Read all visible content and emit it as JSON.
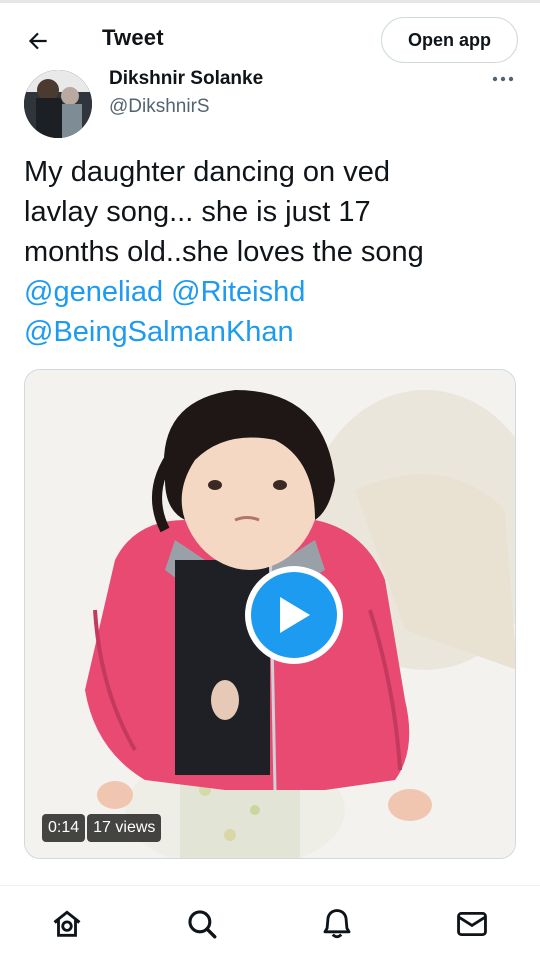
{
  "header": {
    "title": "Tweet",
    "open_app_label": "Open app"
  },
  "author": {
    "name": "Dikshnir Solanke",
    "handle": "@DikshnirS"
  },
  "tweet": {
    "text_lines": [
      "My daughter dancing on ved",
      "lavlay song... she is just 17",
      "months old..she loves the song"
    ],
    "mentions": [
      "@geneliad",
      "@Riteishd",
      "@BeingSalmanKhan"
    ]
  },
  "video": {
    "duration": "0:14",
    "views": "17 views"
  },
  "bottom_nav": {
    "items": [
      "home-icon",
      "search-icon",
      "notifications-icon",
      "messages-icon"
    ]
  },
  "colors": {
    "accent": "#1d9bf0",
    "text": "#0f1419",
    "secondary": "#536471",
    "jacket": "#e84a72"
  }
}
